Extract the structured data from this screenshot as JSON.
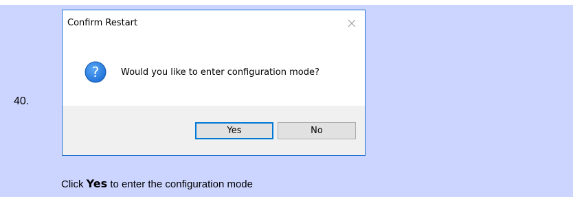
{
  "step": {
    "number": "40."
  },
  "dialog": {
    "title": "Confirm Restart",
    "message": "Would you like to enter configuration mode?",
    "icon": "question-icon",
    "buttons": {
      "yes": "Yes",
      "no": "No"
    }
  },
  "instruction": {
    "prefix": "Click ",
    "action": "Yes",
    "suffix": " to enter the configuration mode"
  },
  "colors": {
    "step_background": "#ccd5ff",
    "dialog_border": "#1f6fd1",
    "dialog_footer": "#f0f0f0",
    "button_face": "#e1e1e1",
    "default_button_border": "#0078d7",
    "question_icon": "#1c6fd6"
  }
}
